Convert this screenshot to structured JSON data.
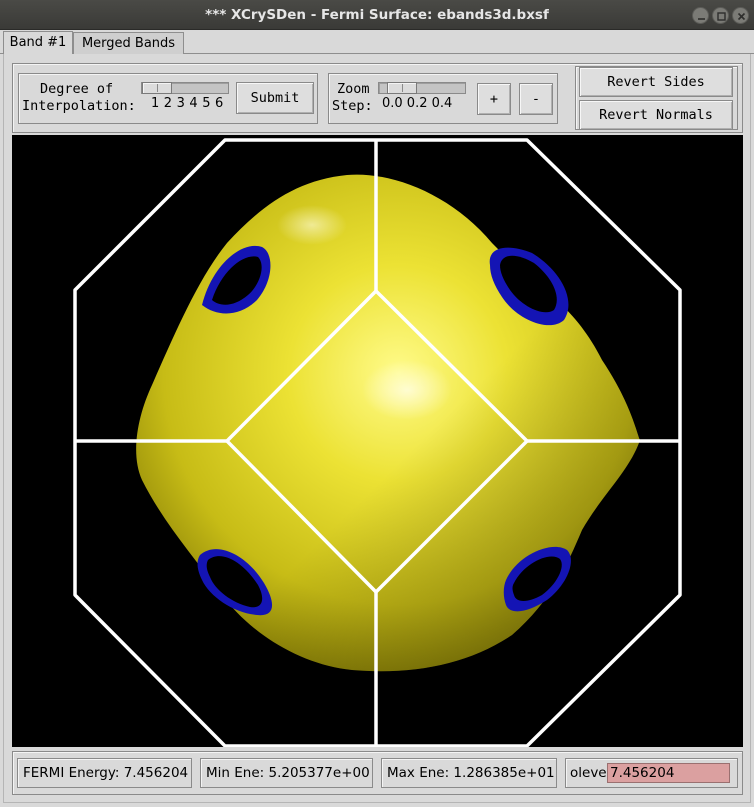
{
  "window": {
    "title": "*** XCrySDen - Fermi Surface: ebands3d.bxsf"
  },
  "tabs": [
    {
      "label": "Band #1",
      "active": true
    },
    {
      "label": "Merged Bands",
      "active": false
    }
  ],
  "interpolation": {
    "label_line1": "Degree of",
    "label_line2": "Interpolation:",
    "scale": "1 2 3 4 5 6",
    "value": 1,
    "submit_label": "Submit"
  },
  "zoom": {
    "label_line1": "Zoom",
    "label_line2": "Step:",
    "scale": "0.0 0.2 0.4",
    "value": 0.0,
    "plus_label": "+",
    "minus_label": "-"
  },
  "actions": {
    "revert_sides_label": "Revert Sides",
    "revert_normals_label": "Revert Normals"
  },
  "tools": [
    {
      "icon": "fermi-surface-icon",
      "selected": false
    },
    {
      "icon": "unit-cell-icon",
      "selected": false
    },
    {
      "icon": "wigner-seitz-cell-icon",
      "selected": false
    },
    {
      "icon": "kpoints-icon",
      "selected": false
    },
    {
      "icon": "bz-kpoints-icon",
      "selected": false
    },
    {
      "icon": "colored-surface-icon",
      "selected": false
    },
    {
      "icon": "brillouin-zone-icon",
      "selected": false
    }
  ],
  "viewport": {
    "surface_color": "#e3d82d",
    "inner_side_color": "#1414b4",
    "zone_edge_color": "#ffffff",
    "background": "#000000"
  },
  "status": {
    "fermi_energy": "FERMI Energy: 7.456204",
    "min_energy": "Min Ene: 5.205377e+00",
    "max_energy": "Max Ene: 1.286385e+01",
    "isolevel_label": "olevel:",
    "isolevel_value": "7.456204"
  }
}
